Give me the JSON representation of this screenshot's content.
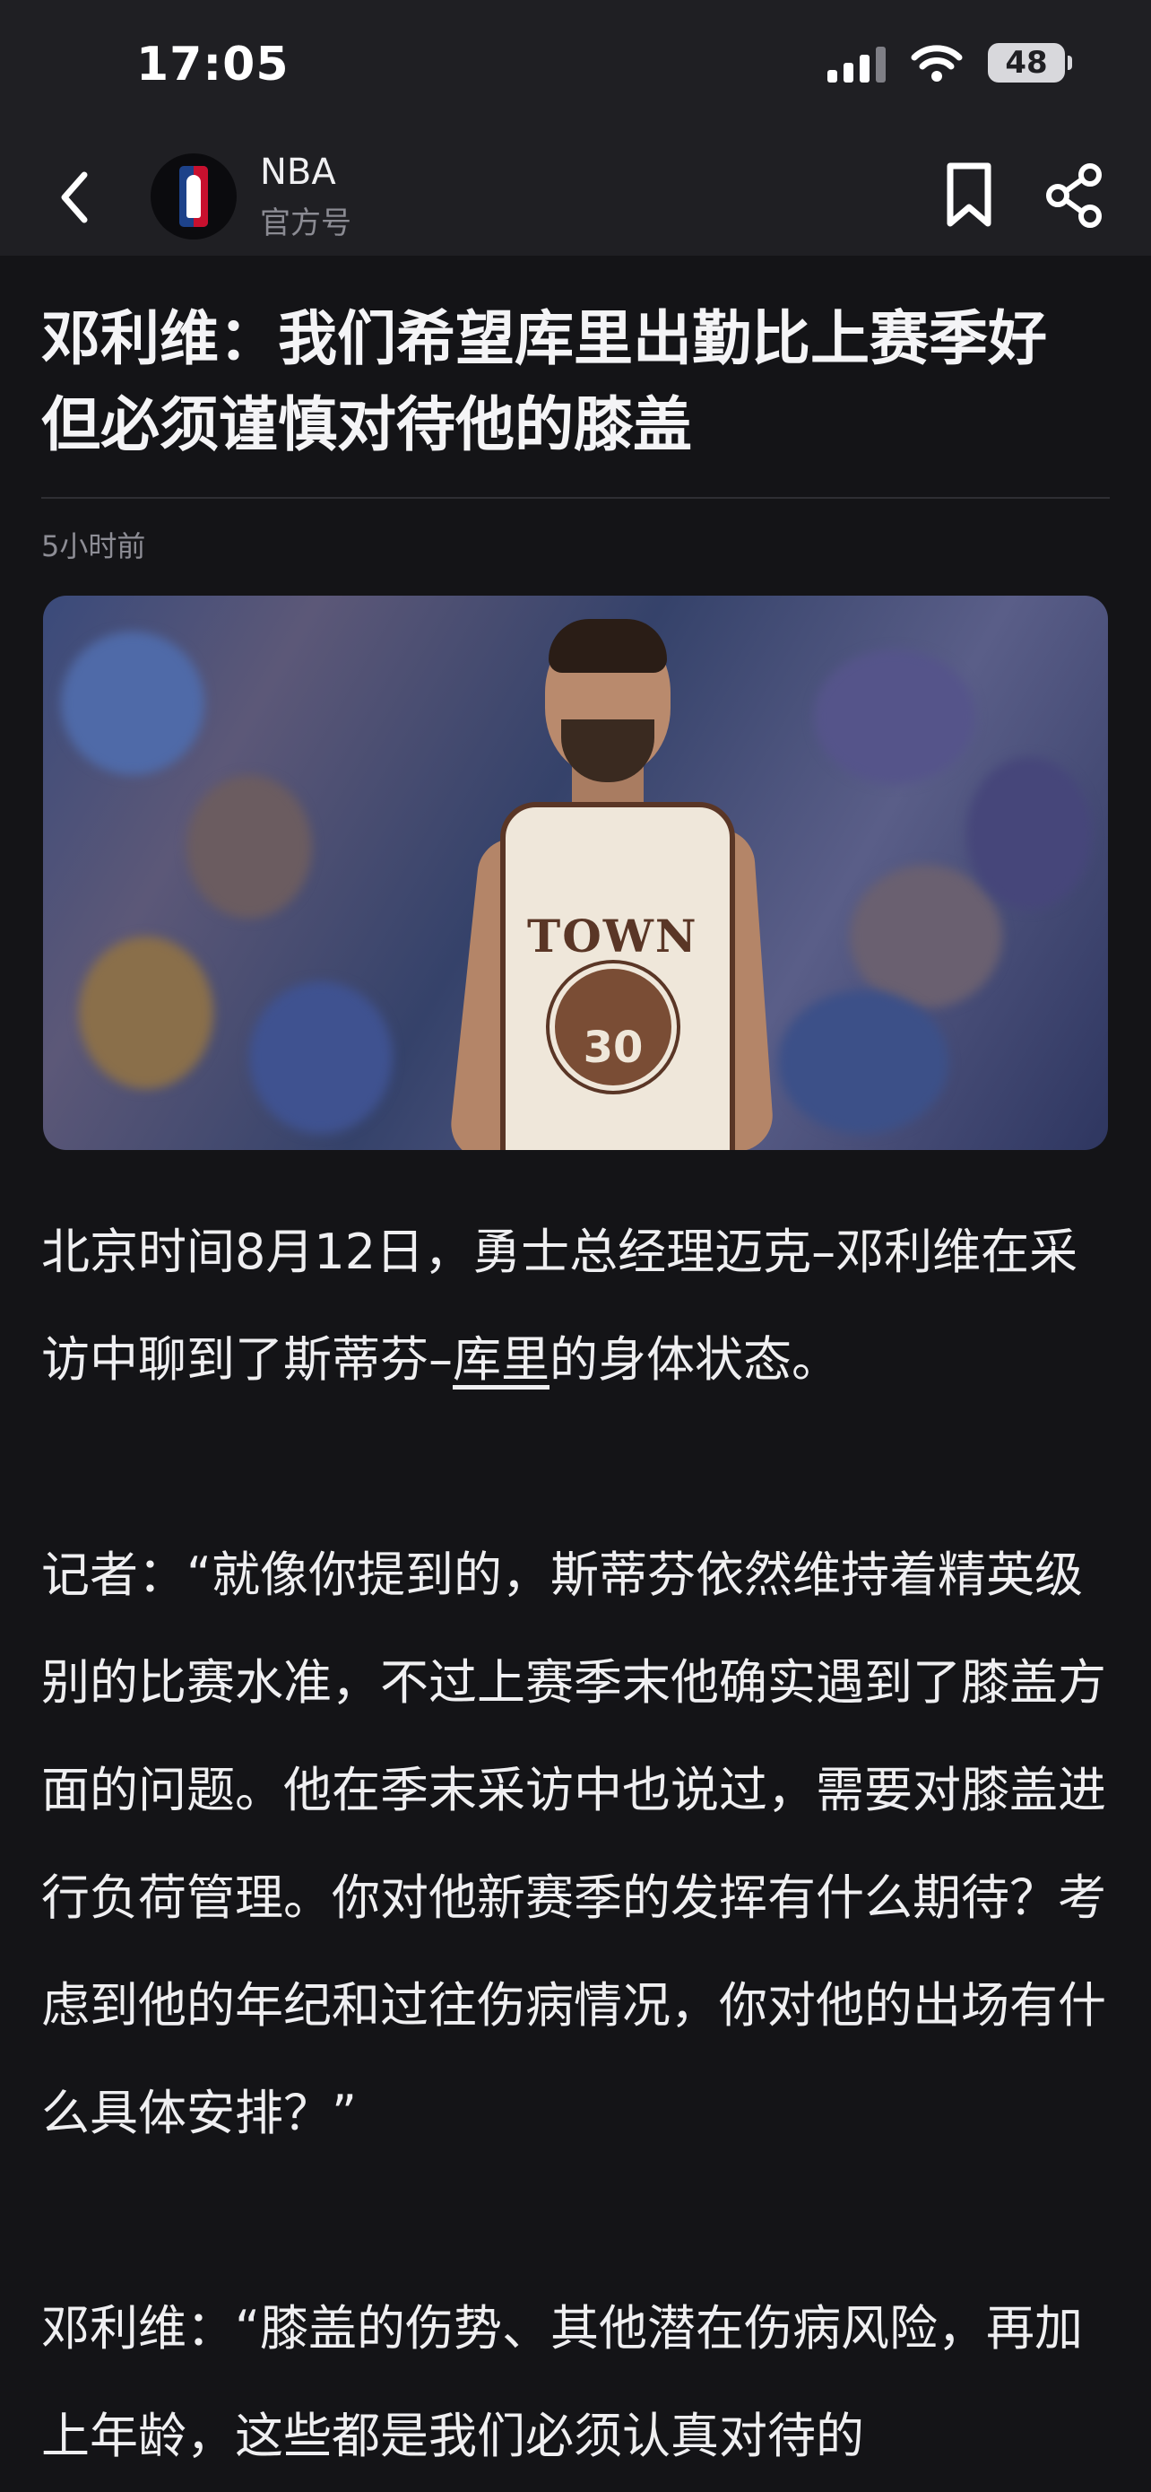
{
  "status": {
    "time": "17:05",
    "battery": "48"
  },
  "account": {
    "name": "NBA",
    "subtitle": "官方号"
  },
  "article": {
    "title": "邓利维：我们希望库里出勤比上赛季好 但必须谨慎对待他的膝盖",
    "time_ago": "5小时前",
    "para1_before_link": "北京时间8月12日，勇士总经理迈克–邓利维在采访中聊到了斯蒂芬–",
    "para1_link": "库里",
    "para1_after_link": "的身体状态。",
    "para2": "记者：“就像你提到的，斯蒂芬依然维持着精英级别的比赛水准，不过上赛季末他确实遇到了膝盖方面的问题。他在季末采访中也说过，需要对膝盖进行负荷管理。你对他新赛季的发挥有什么期待？考虑到他的年纪和过往伤病情况，你对他的出场有什么具体安排？”",
    "para3": "邓利维：“膝盖的伤势、其他潜在伤病风险，再加上年龄，这些都是我们必须认真对待的"
  },
  "image": {
    "jersey_text": "TOWN",
    "jersey_number": "30"
  }
}
